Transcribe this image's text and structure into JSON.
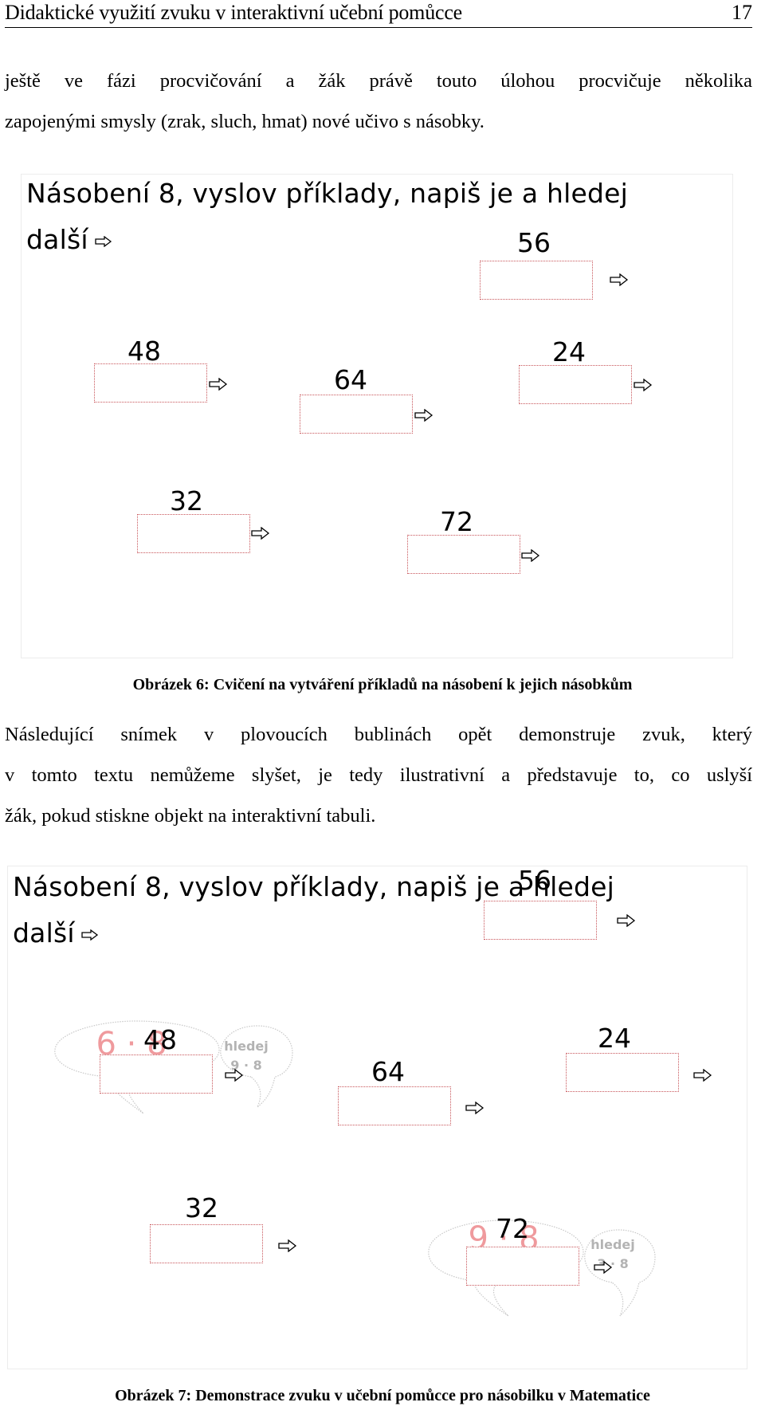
{
  "header": {
    "title": "Didaktické využití zvuku v interaktivní učební pomůcce",
    "page_number": "17"
  },
  "paragraph1": {
    "lines": [
      "ještě ve fázi procvičování a žák právě touto úlohou procvičuje několika",
      "zapojenými smysly (zrak, sluch, hmat) nové učivo s násobky."
    ]
  },
  "figure6": {
    "slide": {
      "title_line1": "Násobení 8, vyslov příklady, napiš je a hledej",
      "title_line2": "další",
      "next_icon": "arrow-right-outline-icon",
      "items": [
        {
          "number": "56",
          "answer": ""
        },
        {
          "number": "48",
          "answer": ""
        },
        {
          "number": "64",
          "answer": ""
        },
        {
          "number": "24",
          "answer": ""
        },
        {
          "number": "32",
          "answer": ""
        },
        {
          "number": "72",
          "answer": ""
        }
      ]
    },
    "caption": "Obrázek 6: Cvičení na vytváření příkladů na násobení k jejich násobkům"
  },
  "paragraph2": {
    "lines": [
      "Následující snímek v plovoucích bublinách opět demonstruje zvuk, který",
      "v tomto textu nemůžeme slyšet, je tedy ilustrativní a představuje to, co uslyší",
      "žák, pokud stiskne objekt na interaktivní tabuli."
    ]
  },
  "figure7": {
    "slide": {
      "title_line1": "Násobení 8, vyslov příklady, napiš je a hledej",
      "title_line2": "další",
      "items": [
        {
          "number": "56",
          "answer": ""
        },
        {
          "number": "48",
          "answer": ""
        },
        {
          "number": "64",
          "answer": ""
        },
        {
          "number": "24",
          "answer": ""
        },
        {
          "number": "32",
          "answer": ""
        },
        {
          "number": "72",
          "answer": ""
        }
      ],
      "bubbles": [
        {
          "spoken": "6 · 8",
          "hint_label": "hledej",
          "hint_value": "9 · 8"
        },
        {
          "spoken": "9 · 8",
          "hint_label": "hledej",
          "hint_value": "3 · 8"
        }
      ]
    },
    "caption": "Obrázek 7: Demonstrace zvuku v učební pomůcce pro násobilku v Matematice"
  },
  "colors": {
    "box_border": "#c8555a",
    "bubble_spoken_text": "#ef9a9d",
    "bubble_hint_text": "#b3b3b3",
    "bubble_outline": "#c8c8c8"
  }
}
